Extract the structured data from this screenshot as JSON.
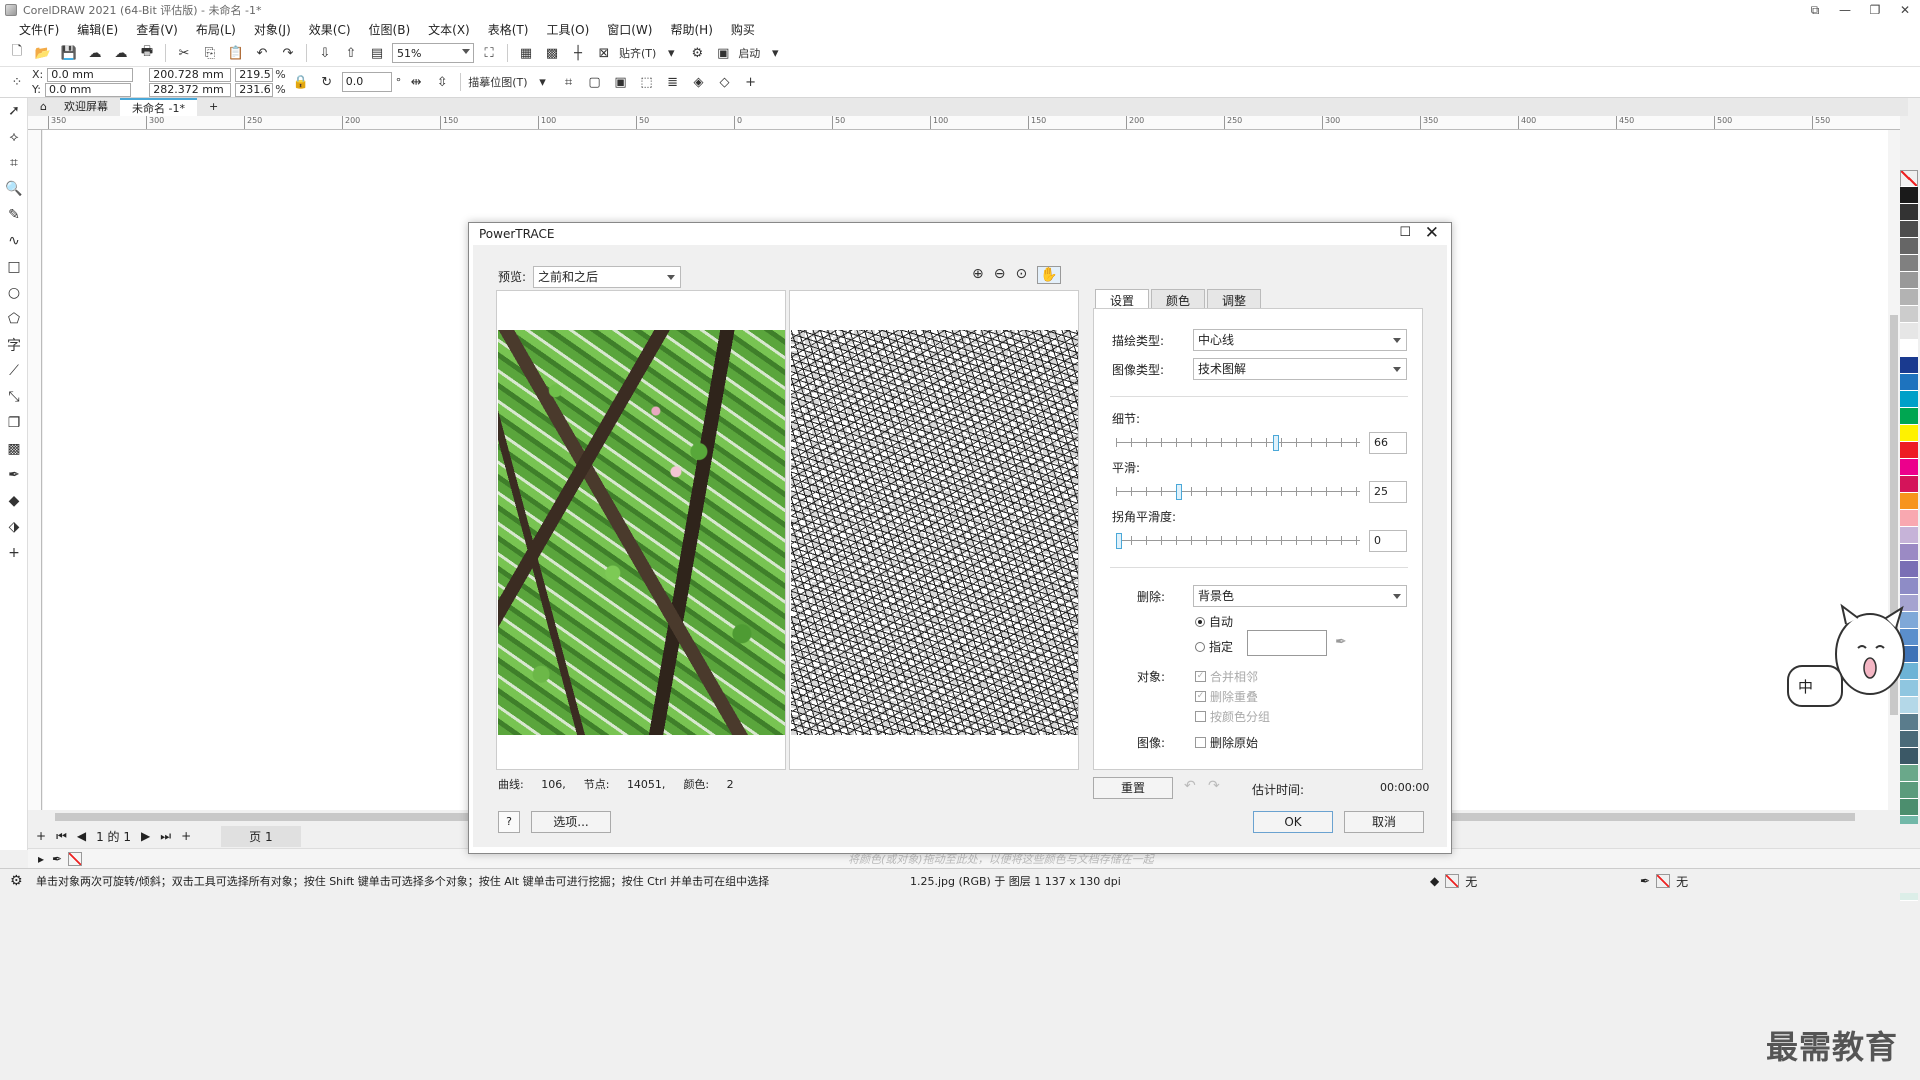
{
  "window": {
    "title": "CorelDRAW 2021 (64-Bit 评估版) - 未命名 -1*"
  },
  "menu": [
    "文件(F)",
    "编辑(E)",
    "查看(V)",
    "布局(L)",
    "对象(J)",
    "效果(C)",
    "位图(B)",
    "文本(X)",
    "表格(T)",
    "工具(O)",
    "窗口(W)",
    "帮助(H)",
    "购买"
  ],
  "toolbar": {
    "zoom": "51%",
    "snap_label": "贴齐(T)",
    "launch_label": "启动"
  },
  "propbar": {
    "x": "0.0 mm",
    "y": "0.0 mm",
    "width": "200.728 mm",
    "height": "282.372 mm",
    "scale_w": "219.5",
    "scale_h": "231.6",
    "pct": "%",
    "rotation": "0.0",
    "degree": "°",
    "trace_label": "描摹位图(T)",
    "x_label": "X:",
    "y_label": "Y:"
  },
  "tabs": {
    "welcome": "欢迎屏幕",
    "document": "未命名 -1*"
  },
  "ruler_ticks": [
    "350",
    "300",
    "250",
    "200",
    "150",
    "100",
    "50",
    "0",
    "50",
    "100",
    "150",
    "200",
    "250",
    "300",
    "350",
    "400",
    "450",
    "500",
    "550"
  ],
  "dialog": {
    "title": "PowerTRACE",
    "preview_label": "预览:",
    "preview_value": "之前和之后",
    "tabs": [
      "设置",
      "颜色",
      "调整"
    ],
    "trace_type_label": "描绘类型:",
    "trace_type_value": "中心线",
    "image_type_label": "图像类型:",
    "image_type_value": "技术图解",
    "detail_label": "细节:",
    "detail_value": "66",
    "detail_level": 0.66,
    "smooth_label": "平滑:",
    "smooth_value": "25",
    "smooth_level": 0.25,
    "corner_label": "拐角平滑度:",
    "corner_value": "0",
    "corner_level": 0.0,
    "remove_label": "删除:",
    "remove_value": "背景色",
    "auto_label": "自动",
    "specify_label": "指定",
    "object_label": "对象:",
    "merge_adjacent": "合并相邻",
    "remove_overlap": "删除重叠",
    "group_by_color": "按颜色分组",
    "image_label": "图像:",
    "delete_original": "删除原始",
    "curves_label": "曲线:",
    "curves_value": "106,",
    "nodes_label": "节点:",
    "nodes_value": "14051,",
    "colors_label": "颜色:",
    "colors_value": "2",
    "help_btn": "?",
    "options_btn": "选项...",
    "reset_btn": "重置",
    "est_time_label": "估计时间:",
    "est_time_value": "00:00:00",
    "ok_btn": "OK",
    "cancel_btn": "取消"
  },
  "pagenav": {
    "page_info": "1 的 1",
    "page_tab": "页 1"
  },
  "colorbar_hint": "将颜色(或对象)拖动至此处，以便将这些颜色与文档存储在一起",
  "status": {
    "text": "单击对象两次可旋转/倾斜；双击工具可选择所有对象；按住 Shift 键单击可选择多个对象；按住 Alt 键单击可进行挖掘；按住 Ctrl 并单击可在组中选择",
    "file_info": "1.25.jpg (RGB) 于 图层 1 137 x 130 dpi",
    "fill_label": "无",
    "outline_label": "无"
  },
  "mascot_text": "中",
  "watermark": "最需教育",
  "palette": [
    "#1a1a1a",
    "#333333",
    "#4d4d4d",
    "#666666",
    "#808080",
    "#999999",
    "#b3b3b3",
    "#cccccc",
    "#e6e6e6",
    "#ffffff",
    "#1a3a8f",
    "#1e73be",
    "#00a0c8",
    "#00a651",
    "#fff200",
    "#ed1c24",
    "#ec008c",
    "#d4145a",
    "#f7941d",
    "#f9a8b0",
    "#c6b3d8",
    "#9b8ac4",
    "#7a6fb5",
    "#8e8cc6",
    "#a5a3d0",
    "#7fa8d8",
    "#5b8fcc",
    "#3f73b7",
    "#6db3d6",
    "#8fc6e0",
    "#b4d8e8",
    "#5a7c8c",
    "#4a6a78",
    "#3b5866",
    "#6aa88a",
    "#5b9b7c",
    "#4c8e6e",
    "#72b8a8",
    "#8ec8b8",
    "#a8d8c8",
    "#c4e4d8",
    "#dceee8"
  ]
}
